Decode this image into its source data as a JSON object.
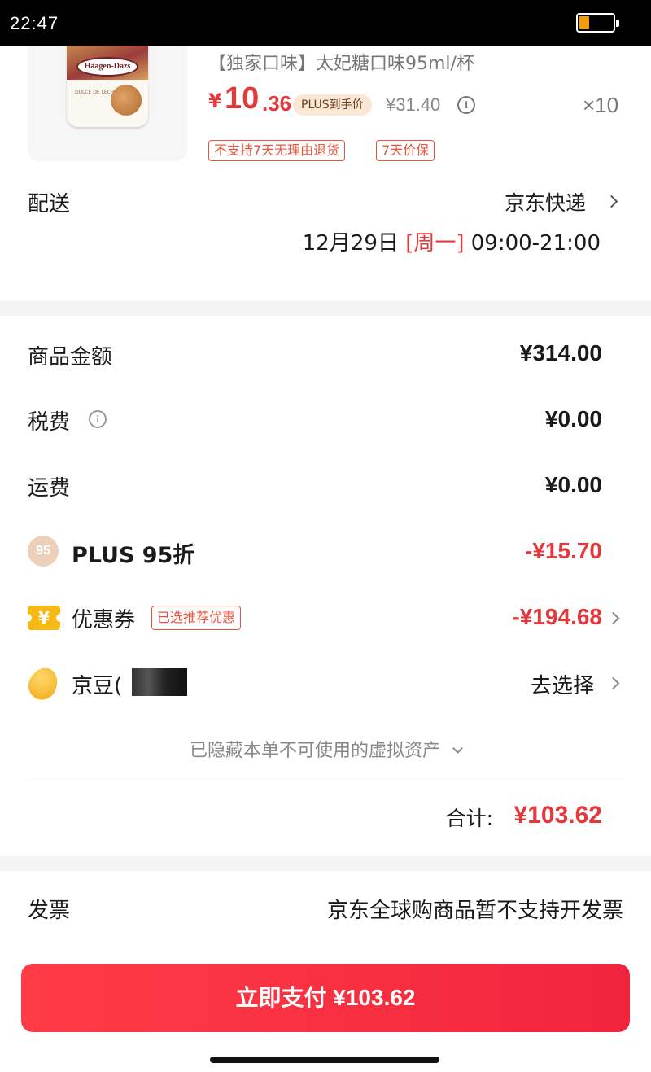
{
  "status_bar": {
    "time": "22:47"
  },
  "product": {
    "logo_text": "Häagen-Dazs",
    "flavor_text": "DULCE DE LECHE",
    "title": "【独家口味】太妃糖口味95ml/杯",
    "price_symbol": "¥",
    "price_integer": "10",
    "price_decimal": ".36",
    "plus_tag": "PLUS到手价",
    "original_price": "¥31.40",
    "quantity": "×10",
    "tags": [
      "不支持7天无理由退货",
      "7天价保"
    ]
  },
  "delivery": {
    "label": "配送",
    "method": "京东快递",
    "date": "12月29日",
    "weekday": "[周一]",
    "time_window": "09:00-21:00"
  },
  "summary": {
    "goods_label": "商品金额",
    "goods_value": "¥314.00",
    "tax_label": "税费",
    "tax_value": "¥0.00",
    "shipping_label": "运费",
    "shipping_value": "¥0.00",
    "plus_badge": "95",
    "plus_label": "PLUS 95折",
    "plus_value": "-¥15.70",
    "coupon_icon": "¥",
    "coupon_label": "优惠券",
    "coupon_tag": "已选推荐优惠",
    "coupon_value": "-¥194.68",
    "beans_label": "京豆(",
    "beans_action": "去选择",
    "hidden_note": "已隐藏本单不可使用的虚拟资产",
    "total_label": "合计:",
    "total_value": "¥103.62"
  },
  "invoice": {
    "label": "发票",
    "value": "京东全球购商品暂不支持开发票"
  },
  "pay_button": {
    "label": "立即支付 ¥103.62"
  },
  "colors": {
    "accent_red": "#e4393c",
    "pay_button": "#f2243d",
    "coupon_icon": "#f7b916",
    "plus_badge": "#ecd0b9"
  }
}
